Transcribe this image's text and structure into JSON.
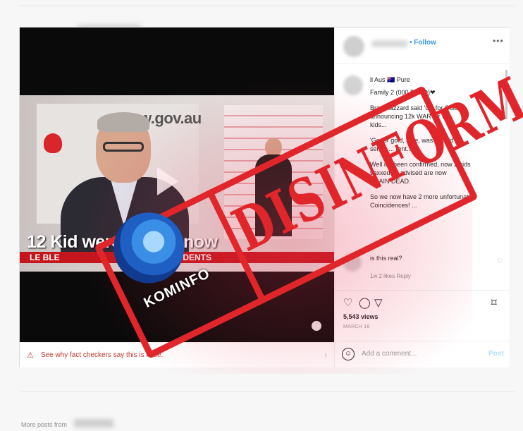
{
  "post": {
    "gov_text": "w.gov.au",
    "caption_overlay": "12 Kid     were     ol   an    s now",
    "ticker_left": "LE  BLE",
    "ticker_text": "  FOR HSC STUDENTS",
    "fact_check_text": "See why fact checkers say this is false."
  },
  "sidebar": {
    "follow_label": "• Follow",
    "more_label": "•••",
    "caption_lines": [
      "       ll Aus 🇦🇺 Pure",
      "Family 2 (000 DEAD)❤",
      "Brad Hazzard said 'Go for Gold'",
      "announcing 12k         WAR for the",
      "kids...",
      "'Go for gold, safe, was a Gold",
      "sense ...            rent...",
      "Well it's been confirmed, now 2 kids",
      "       vaxxed as advised are now",
      "BRAIN DEAD.",
      "So we now have 2 more unfortunate",
      "Coincidences! ..."
    ],
    "comment_text": "is this real?",
    "comment_meta": "1w   2 likes   Reply",
    "views": "5,543 views",
    "date": "MARCH 16",
    "comment_placeholder": "Add a comment...",
    "post_label": "Post"
  },
  "stamp": {
    "text": "DISINFORMASI",
    "logo_label": "KOMINFO"
  },
  "footer": {
    "more_posts": "More posts from"
  },
  "colors": {
    "stamp_red": "#e0262b",
    "link_blue": "#3897f0",
    "ticker_red": "#c4161c"
  },
  "icons": [
    "heart-icon",
    "comment-icon",
    "share-icon",
    "bookmark-icon",
    "emoji-icon",
    "warning-icon",
    "mute-icon",
    "play-icon"
  ]
}
